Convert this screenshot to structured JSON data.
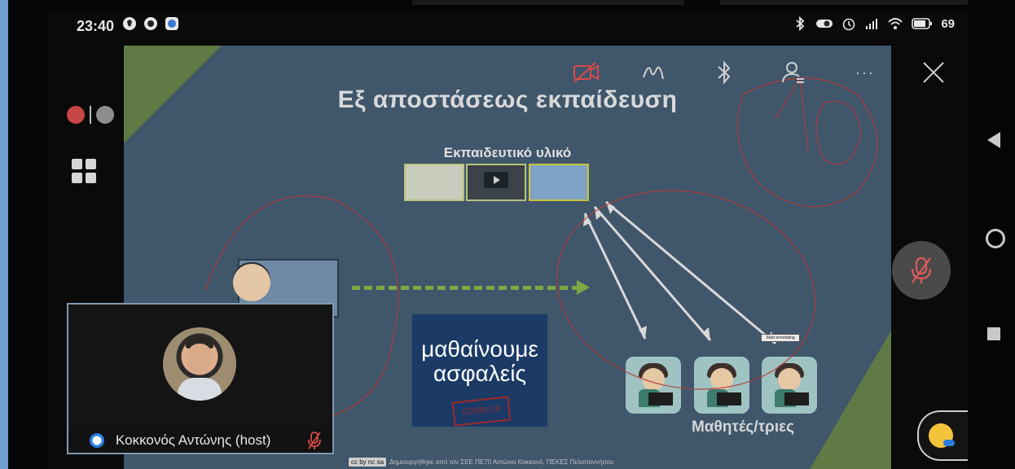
{
  "status_bar": {
    "time": "23:40",
    "left_icons": [
      "shield-icon",
      "circle-app-icon",
      "app-icon"
    ],
    "right_icons": [
      "bluetooth-icon",
      "toggle-icon",
      "alarm-icon",
      "signal-icon",
      "wifi-icon",
      "battery-icon"
    ],
    "battery_level": "69"
  },
  "toolbar": {
    "buttons": [
      "video-off-icon",
      "annotate-icon",
      "bluetooth-icon",
      "participants-icon",
      "more-icon",
      "close-icon"
    ],
    "more_label": "···"
  },
  "slide": {
    "title": "Εξ αποστάσεως εκπαίδευση",
    "material_label": "Εκπαιδευτικό υλικό",
    "safe_text": "μαθαίνουμε ασφαλείς",
    "covid_stamp": "COVID-19",
    "students_label": "Μαθητές/τριες",
    "annotation_tooltip": "Start annotating",
    "footer_badge": "cc by nc sa",
    "footer_credit": "Δημιουργήθηκε από τον ΣΕΕ ΠΕ70 Αντώνιο Κοκκονό, ΠΕΚΕΣ Πελοποννήσου"
  },
  "video_tile": {
    "participant_name": "Κοκκονός Αντώνης (host)",
    "mic_status": "muted"
  },
  "colors": {
    "slide_bg": "#3f566b",
    "accent_green": "#7fa843",
    "annotation_red": "#b43b3b",
    "arrow_white": "#d9d9d9"
  }
}
